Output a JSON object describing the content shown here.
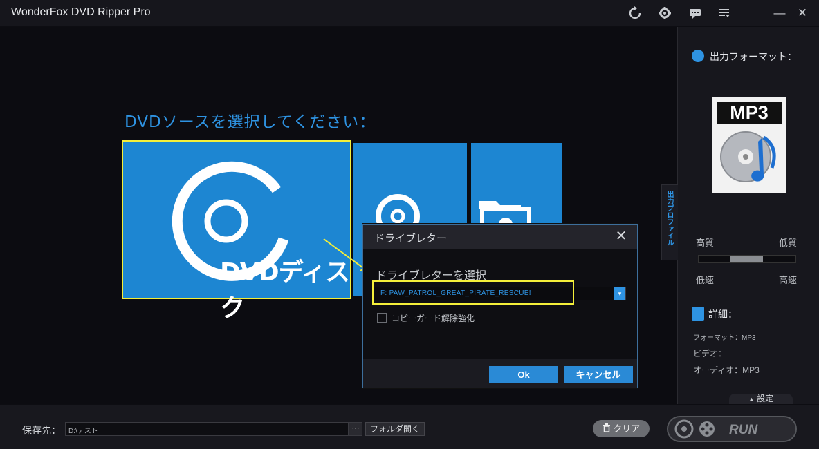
{
  "window": {
    "title": "WonderFox DVD Ripper Pro",
    "icons": [
      "refresh-icon",
      "toolbox-icon",
      "feedback-icon",
      "menu-icon",
      "minimize-icon",
      "close-icon"
    ],
    "minimize_glyph": "—",
    "close_glyph": "✕"
  },
  "main": {
    "prompt": "DVDソースを選択してください：",
    "tiles": [
      {
        "label": "DVDディスク",
        "icon": "dvd-disc-icon"
      },
      {
        "label": "",
        "icon": "iso-image-icon"
      },
      {
        "label": "",
        "icon": "dvd-folder-icon"
      }
    ]
  },
  "right_panel": {
    "output_format_title": "出力フォーマット：",
    "format_name": "MP3",
    "profile_tab": "出力プロファイル",
    "quality_high": "高質",
    "quality_low": "低質",
    "speed_low": "低速",
    "speed_high": "高速",
    "details_title": "詳細：",
    "details": {
      "format": "フォーマット：MP3",
      "video": "ビデオ：",
      "audio": "オーディオ：MP3"
    },
    "settings_tab": "設定",
    "settings_glyph": "▲"
  },
  "bottom": {
    "save_label": "保存先：",
    "save_path": "D:\\テスト",
    "browse_dots": "···",
    "open_folder": "フォルダ開く",
    "clear": "クリア",
    "run": "RUN"
  },
  "dialog": {
    "title": "ドライブレター",
    "close_glyph": "✕",
    "label": "ドライブレターを選択",
    "drive_value": "F:  PAW_PATROL_GREAT_PIRATE_RESCUE!",
    "checkbox_label": "コピーガード解除強化",
    "checkbox_checked": false,
    "ok": "Ok",
    "cancel": "キャンセル",
    "caret": "▾"
  },
  "colors": {
    "accent": "#2e93e2",
    "tile": "#1d86d2",
    "highlight": "#f4ef3a"
  }
}
